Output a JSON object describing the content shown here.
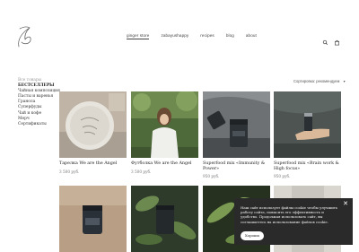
{
  "header": {
    "nav": [
      {
        "label": "ginger store",
        "active": true
      },
      {
        "label": "zabayushappy",
        "active": false
      },
      {
        "label": "recipes",
        "active": false
      },
      {
        "label": "blog",
        "active": false
      },
      {
        "label": "about",
        "active": false
      }
    ]
  },
  "sidebar": {
    "all": "Все товары",
    "bestsellers": "БЕСТСЕЛЛЕРЫ",
    "items": [
      "Чайная композиция",
      "Пасты и варенья",
      "Гранола",
      "Суперфуды",
      "Чай и кофе",
      "Мерч",
      "Сертификаты"
    ]
  },
  "sort": {
    "label": "Сортировка: рекомендуем",
    "arrow": "▾"
  },
  "products": [
    {
      "name": "Тарелка We are the Angel",
      "price": "3 500 руб."
    },
    {
      "name": "Футболка We are the Angel",
      "price": "3 500 руб."
    },
    {
      "name": "Superfood mix «Immunity & Power»",
      "price": "950 руб."
    },
    {
      "name": "Superfood mix «Brain work & High focus»",
      "price": "950 руб."
    }
  ],
  "cookie": {
    "text": "Наш сайт использует файлы cookie чтобы улучшить работу сайта, повысить его эффективность и удобство. Продолжая использовать сайт, вы соглашаетесь на использование файлов cookie.",
    "button": "Хорошо",
    "close": "✕"
  }
}
